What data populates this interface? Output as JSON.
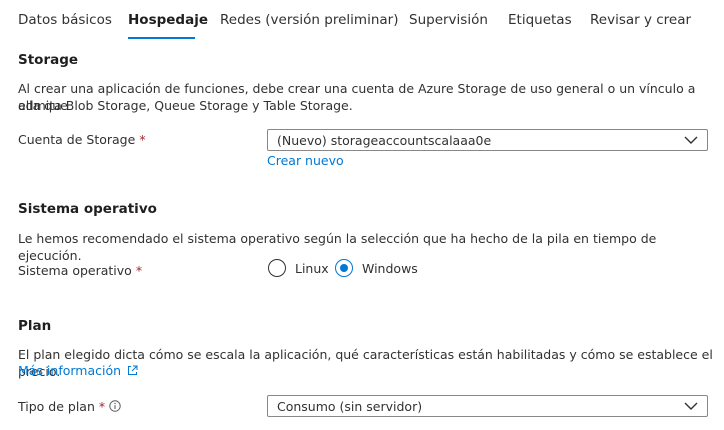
{
  "tabs": [
    {
      "label": "Datos básicos"
    },
    {
      "label": "Hospedaje"
    },
    {
      "label": "Redes (versión preliminar)"
    },
    {
      "label": "Supervisión"
    },
    {
      "label": "Etiquetas"
    },
    {
      "label": "Revisar y crear"
    }
  ],
  "active_tab": "Hospedaje",
  "storage": {
    "title": "Storage",
    "description_line1": "Al crear una aplicación de funciones, debe crear una cuenta de Azure Storage de uso general o un vínculo a ella que",
    "description_line2": "admita Blob Storage, Queue Storage y Table Storage.",
    "field_label": "Cuenta de Storage",
    "required_mark": "*",
    "selected_value": "(Nuevo) storageaccountscalaaa0e",
    "create_new_link": "Crear nuevo"
  },
  "os": {
    "title": "Sistema operativo",
    "description": "Le hemos recomendado el sistema operativo según la selección que ha hecho de la pila en tiempo de ejecución.",
    "field_label": "Sistema operativo",
    "required_mark": "*",
    "options": [
      {
        "label": "Linux",
        "checked": false
      },
      {
        "label": "Windows",
        "checked": true
      }
    ]
  },
  "plan": {
    "title": "Plan",
    "description": "El plan elegido dicta cómo se escala la aplicación, qué características están habilitadas y cómo se establece el precio.",
    "more_info_link": "Más información",
    "field_label": "Tipo de plan",
    "required_mark": "*",
    "selected_value": "Consumo (sin servidor)"
  },
  "colors": {
    "accent": "#0078d4",
    "required": "#a4262c",
    "text": "#323130"
  }
}
